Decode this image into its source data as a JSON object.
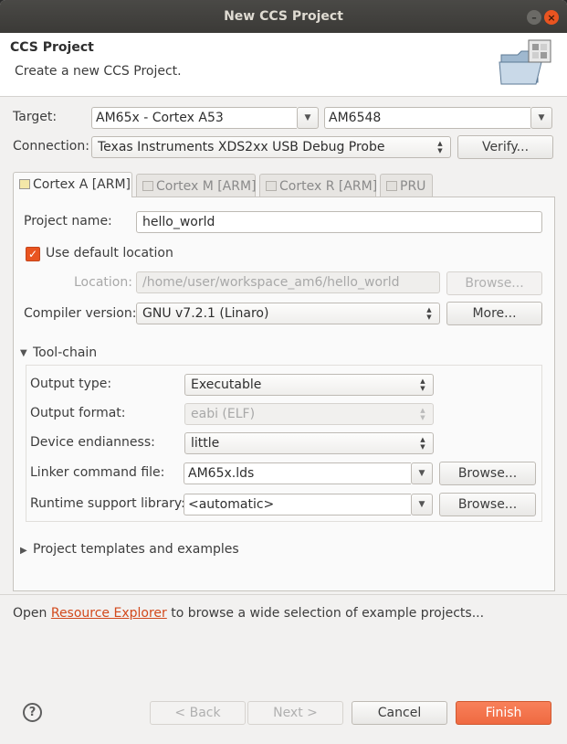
{
  "window": {
    "title": "New CCS Project",
    "minimize_glyph": "–",
    "close_glyph": "×"
  },
  "header": {
    "title": "CCS Project",
    "description": "Create a new CCS Project.",
    "icon": "folder-project-icon"
  },
  "target": {
    "label": "Target:",
    "family_value": "AM65x - Cortex A53",
    "device_value": "AM6548"
  },
  "connection": {
    "label": "Connection:",
    "value": "Texas Instruments XDS2xx USB Debug Probe",
    "verify_label": "Verify..."
  },
  "tabs": [
    {
      "label": "Cortex A [ARM]",
      "active": true
    },
    {
      "label": "Cortex M [ARM]",
      "active": false
    },
    {
      "label": "Cortex R [ARM]",
      "active": false
    },
    {
      "label": "PRU",
      "active": false
    }
  ],
  "project": {
    "name_label": "Project name:",
    "name_value": "hello_world",
    "use_default_label": "Use default location",
    "use_default_checked": true,
    "location_label": "Location:",
    "location_value": "/home/user/workspace_am6/hello_world",
    "browse_label": "Browse...",
    "compiler_label": "Compiler version:",
    "compiler_value": "GNU v7.2.1 (Linaro)",
    "more_label": "More..."
  },
  "toolchain": {
    "title": "Tool-chain",
    "output_type_label": "Output type:",
    "output_type_value": "Executable",
    "output_format_label": "Output format:",
    "output_format_value": "eabi (ELF)",
    "endianness_label": "Device endianness:",
    "endianness_value": "little",
    "linker_label": "Linker command file:",
    "linker_value": "AM65x.lds",
    "runtime_label": "Runtime support library:",
    "runtime_value": "<automatic>",
    "browse_label": "Browse..."
  },
  "templates": {
    "title": "Project templates and examples"
  },
  "resource": {
    "prefix": "Open ",
    "link": "Resource Explorer",
    "suffix": " to browse a wide selection of example projects..."
  },
  "footer": {
    "help_glyph": "?",
    "back_label": "< Back",
    "next_label": "Next >",
    "cancel_label": "Cancel",
    "finish_label": "Finish"
  },
  "colors": {
    "accent": "#e95420",
    "link": "#d2491c",
    "titlebar": "#3b3a37"
  }
}
